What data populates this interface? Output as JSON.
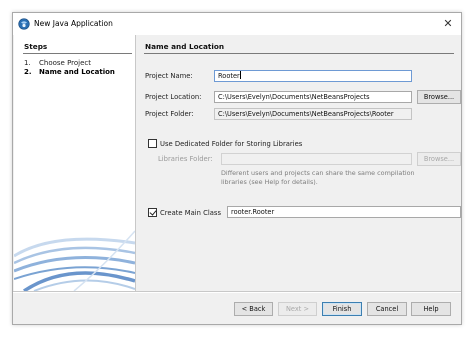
{
  "window": {
    "title": "New Java Application",
    "close_glyph": "✕"
  },
  "steps": {
    "title": "Steps",
    "items": [
      {
        "num": "1.",
        "label": "Choose Project",
        "active": false
      },
      {
        "num": "2.",
        "label": "Name and Location",
        "active": true
      }
    ]
  },
  "form": {
    "section_title": "Name and Location",
    "project_name": {
      "label": "Project Name:",
      "value": "Rooter"
    },
    "project_location": {
      "label": "Project Location:",
      "value": "C:\\Users\\Evelyn\\Documents\\NetBeansProjects"
    },
    "project_folder": {
      "label": "Project Folder:",
      "value": "C:\\Users\\Evelyn\\Documents\\NetBeansProjects\\Rooter"
    },
    "browse_label": "Browse...",
    "dedicated_folder": {
      "label": "Use Dedicated Folder for Storing Libraries",
      "checked": false
    },
    "libraries_folder": {
      "label": "Libraries Folder:",
      "value": ""
    },
    "browse_disabled_label": "Browse...",
    "hint_line1": "Different users and projects can share the same compilation",
    "hint_line2": "libraries (see Help for details).",
    "main_class": {
      "label": "Create Main Class",
      "checked": true,
      "value": "rooter.Rooter"
    }
  },
  "footer": {
    "back": "< Back",
    "next": "Next >",
    "finish": "Finish",
    "cancel": "Cancel",
    "help": "Help"
  },
  "colors": {
    "accent": "#3c7fb1",
    "panel_bg": "#f0f0f0",
    "decor_blue": "#5b8fc9"
  }
}
